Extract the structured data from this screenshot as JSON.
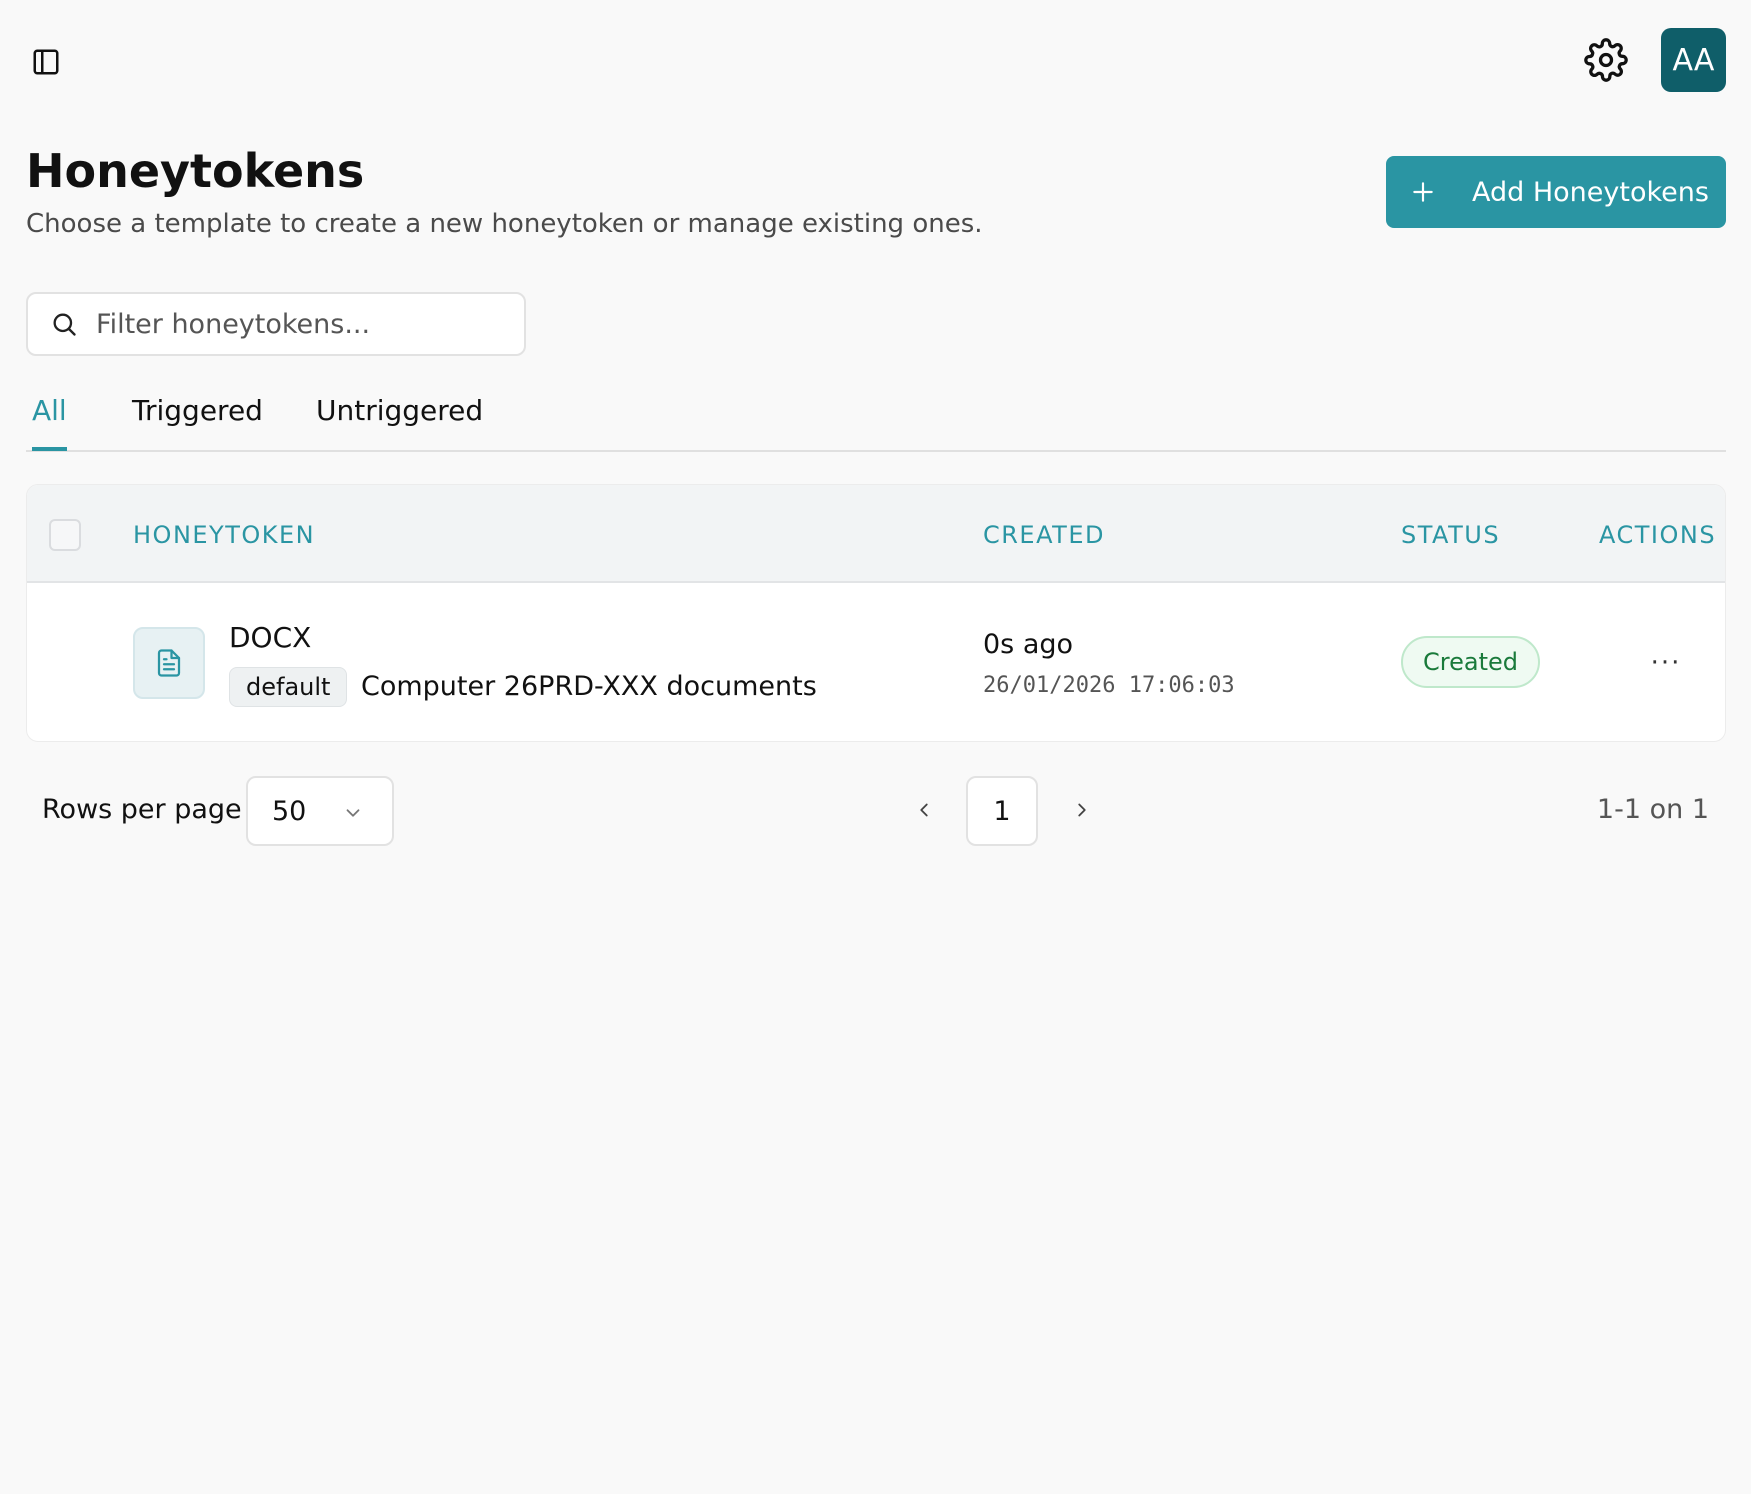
{
  "header": {
    "sidebar_toggle_icon": "sidebar-toggle-icon",
    "settings_icon": "gear-icon",
    "avatar_initials": "AA"
  },
  "page": {
    "title": "Honeytokens",
    "subtitle": "Choose a template to create a new honeytoken or manage existing ones.",
    "add_button_label": "Add Honeytokens"
  },
  "search": {
    "placeholder": "Filter honeytokens...",
    "value": ""
  },
  "tabs": [
    {
      "label": "All",
      "active": true
    },
    {
      "label": "Triggered",
      "active": false
    },
    {
      "label": "Untriggered",
      "active": false
    }
  ],
  "table": {
    "columns": [
      "HONEYTOKEN",
      "CREATED",
      "STATUS",
      "ACTIONS"
    ],
    "rows": [
      {
        "icon": "document-icon",
        "name": "DOCX",
        "tag": "default",
        "description": "Computer 26PRD-XXX documents",
        "created_relative": "0s ago",
        "created_datetime": "26/01/2026 17:06:03",
        "status": "Created",
        "actions_label": "···"
      }
    ]
  },
  "pagination": {
    "rows_per_page_label": "Rows per page",
    "rows_per_page_value": "50",
    "current_page": "1",
    "range_info": "1-1 on 1"
  },
  "colors": {
    "accent": "#2a95a3",
    "avatar_bg": "#0f5e69",
    "status_green": "#1a7a3b"
  }
}
